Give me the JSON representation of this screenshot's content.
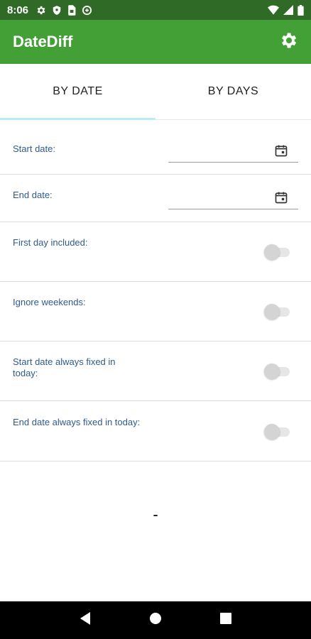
{
  "status_bar": {
    "time": "8:06",
    "left_icons": [
      "gear-icon",
      "shield-icon",
      "sim-card-icon",
      "data-saver-icon"
    ],
    "right_icons": [
      "wifi-icon",
      "signal-icon",
      "battery-icon"
    ]
  },
  "app_bar": {
    "title": "DateDiff",
    "settings_icon": "gear-icon"
  },
  "tabs": [
    {
      "label": "BY DATE",
      "active": true
    },
    {
      "label": "BY DAYS",
      "active": false
    }
  ],
  "form": {
    "start_date": {
      "label": "Start date:",
      "value": "",
      "icon": "calendar-icon"
    },
    "end_date": {
      "label": "End date:",
      "value": "",
      "icon": "calendar-icon"
    },
    "toggles": [
      {
        "label": "First day included:",
        "checked": false
      },
      {
        "label": "Ignore weekends:",
        "checked": false
      },
      {
        "label": "Start date always fixed in today:",
        "checked": false
      },
      {
        "label": "End date always fixed in today:",
        "checked": false
      }
    ]
  },
  "result": {
    "text": "-"
  },
  "nav_bar": {
    "items": [
      "back-icon",
      "home-icon",
      "recents-icon"
    ]
  },
  "colors": {
    "status_bar": "#2f6b27",
    "app_bar": "#43a036",
    "tab_indicator": "#b8ecf8",
    "label_text": "#2e5b8c"
  }
}
